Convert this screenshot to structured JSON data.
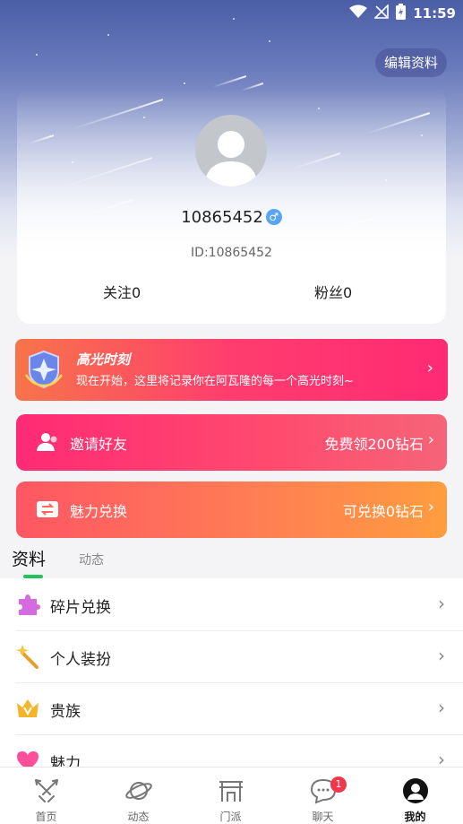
{
  "status_bar": {
    "time": "11:59"
  },
  "header": {
    "edit_button": "编辑资料"
  },
  "profile": {
    "username": "10865452",
    "gender_symbol": "♂",
    "user_id": "ID:10865452",
    "following": "关注0",
    "followers": "粉丝0"
  },
  "highlight": {
    "title": "高光时刻",
    "description": "现在开始，这里将记录你在阿瓦隆的每一个高光时刻~"
  },
  "promos": {
    "invite": {
      "label": "邀请好友",
      "right": "免费领200钻石"
    },
    "charm": {
      "label": "魅力兑换",
      "right": "可兑换0钻石"
    }
  },
  "tabs": {
    "active": "资料",
    "other": "动态"
  },
  "menu": [
    {
      "label": "碎片兑换",
      "icon": "puzzle-icon"
    },
    {
      "label": "个人装扮",
      "icon": "magic-wand-icon"
    },
    {
      "label": "贵族",
      "icon": "crown-icon"
    },
    {
      "label": "魅力",
      "icon": "heart-icon"
    }
  ],
  "bottom_nav": [
    {
      "label": "首页",
      "icon": "crossed-swords-icon"
    },
    {
      "label": "动态",
      "icon": "planet-icon"
    },
    {
      "label": "门派",
      "icon": "gate-icon"
    },
    {
      "label": "聊天",
      "icon": "chat-bubble-icon",
      "badge": "1"
    },
    {
      "label": "我的",
      "icon": "profile-avatar-icon",
      "active": true
    }
  ],
  "colors": {
    "accent_green": "#22c45a",
    "badge_red": "#f2374b",
    "invite_gradient_start": "#ff2a74",
    "charm_gradient_end": "#ff9d3e"
  }
}
